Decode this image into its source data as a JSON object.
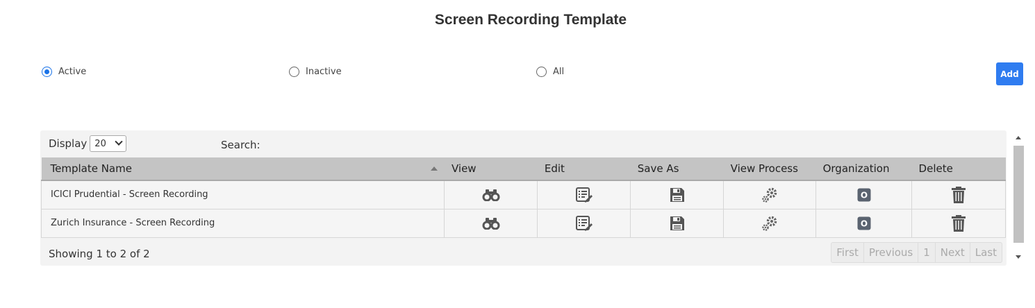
{
  "page": {
    "title": "Screen Recording Template"
  },
  "filters": [
    {
      "label": "Active",
      "checked": true
    },
    {
      "label": "Inactive",
      "checked": false
    },
    {
      "label": "All",
      "checked": false
    }
  ],
  "toolbar": {
    "add_label": "Add"
  },
  "table_controls": {
    "display_label": "Display",
    "page_size": "20",
    "search_label": "Search:"
  },
  "table": {
    "columns": [
      "Template Name",
      "View",
      "Edit",
      "Save As",
      "View Process",
      "Organization",
      "Delete"
    ],
    "rows": [
      {
        "name": "ICICI Prudential - Screen Recording"
      },
      {
        "name": "Zurich Insurance - Screen Recording"
      }
    ],
    "icons": [
      "binoculars-icon",
      "edit-list-icon",
      "floppy-save-icon",
      "gears-icon",
      "organization-o-icon",
      "trash-icon"
    ],
    "org_badge": "O"
  },
  "footer": {
    "showing": "Showing 1 to 2 of 2",
    "pager": [
      "First",
      "Previous",
      "1",
      "Next",
      "Last"
    ]
  },
  "colors": {
    "accent": "#2f7cf0",
    "header_bg": "#c4c4c4",
    "icon_gray": "#666666"
  }
}
